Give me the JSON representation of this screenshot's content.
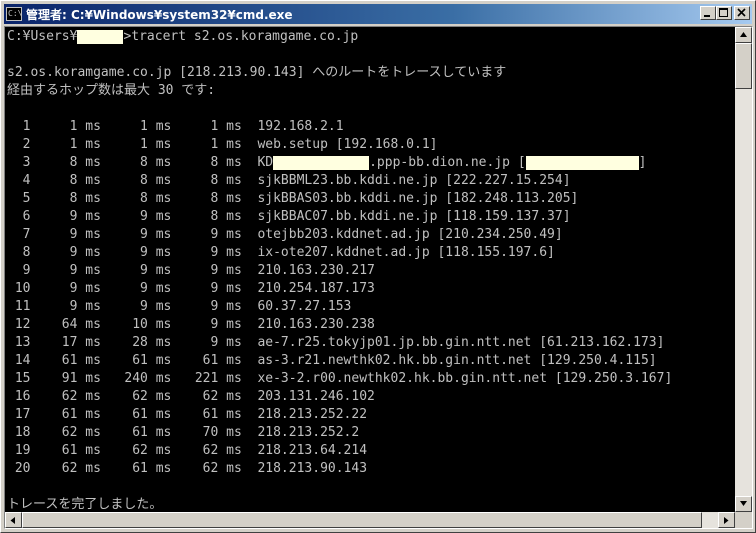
{
  "window": {
    "title": "管理者: C:¥Windows¥system32¥cmd.exe",
    "icon": "console-icon"
  },
  "console": {
    "prompt_prefix": "C:¥Users¥",
    "prompt_suffix": ">tracert s2.os.koramgame.co.jp",
    "header_1": "s2.os.koramgame.co.jp [218.213.90.143] へのルートをトレースしています",
    "header_2": "経由するホップ数は最大 30 です:",
    "hop_3_prefix": "  3     8 ms     8 ms     8 ms  KD",
    "hop_3_middle": ".ppp-bb.dion.ne.jp [",
    "hop_3_suffix": "]",
    "hops": [
      "  1     1 ms     1 ms     1 ms  192.168.2.1",
      "  2     1 ms     1 ms     1 ms  web.setup [192.168.0.1]",
      "  4     8 ms     8 ms     8 ms  sjkBBML23.bb.kddi.ne.jp [222.227.15.254]",
      "  5     8 ms     8 ms     8 ms  sjkBBAS03.bb.kddi.ne.jp [182.248.113.205]",
      "  6     9 ms     9 ms     8 ms  sjkBBAC07.bb.kddi.ne.jp [118.159.137.37]",
      "  7     9 ms     9 ms     9 ms  otejbb203.kddnet.ad.jp [210.234.250.49]",
      "  8     9 ms     9 ms     9 ms  ix-ote207.kddnet.ad.jp [118.155.197.6]",
      "  9     9 ms     9 ms     9 ms  210.163.230.217",
      " 10     9 ms     9 ms     9 ms  210.254.187.173",
      " 11     9 ms     9 ms     9 ms  60.37.27.153",
      " 12    64 ms    10 ms     9 ms  210.163.230.238",
      " 13    17 ms    28 ms     9 ms  ae-7.r25.tokyjp01.jp.bb.gin.ntt.net [61.213.162.173]",
      " 14    61 ms    61 ms    61 ms  as-3.r21.newthk02.hk.bb.gin.ntt.net [129.250.4.115]",
      " 15    91 ms   240 ms   221 ms  xe-3-2.r00.newthk02.hk.bb.gin.ntt.net [129.250.3.167]",
      " 16    62 ms    62 ms    62 ms  203.131.246.102",
      " 17    61 ms    61 ms    61 ms  218.213.252.22",
      " 18    62 ms    61 ms    70 ms  218.213.252.2",
      " 19    61 ms    62 ms    62 ms  218.213.64.214",
      " 20    62 ms    61 ms    62 ms  218.213.90.143"
    ],
    "footer": "トレースを完了しました。"
  }
}
